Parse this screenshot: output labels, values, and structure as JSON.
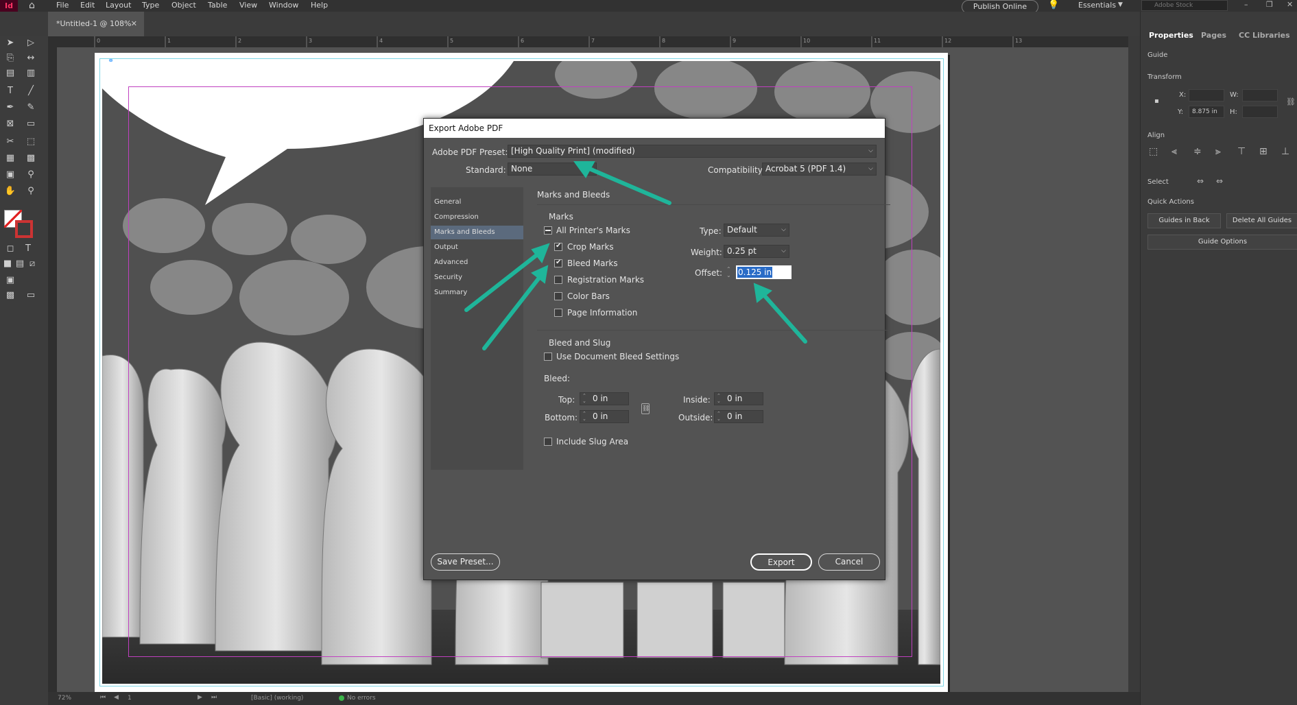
{
  "app": {
    "logo": "Id",
    "menu": [
      "File",
      "Edit",
      "Layout",
      "Type",
      "Object",
      "Table",
      "View",
      "Window",
      "Help"
    ],
    "publish_label": "Publish Online",
    "workspace": "Essentials",
    "stock_placeholder": "Adobe Stock"
  },
  "document": {
    "tab_label": "*Untitled-1 @ 108%",
    "ruler_ticks": [
      "0",
      "1",
      "2",
      "3",
      "4",
      "5",
      "6",
      "7",
      "8",
      "9",
      "10",
      "11",
      "12",
      "13"
    ]
  },
  "status": {
    "zoom": "72%",
    "page": "1",
    "style": "[Basic] (working)",
    "errors": "No errors"
  },
  "right_panel": {
    "tabs": [
      "Properties",
      "Pages",
      "CC Libraries"
    ],
    "context": "Guide",
    "transform_label": "Transform",
    "x_label": "X:",
    "y_label": "Y:",
    "w_label": "W:",
    "h_label": "H:",
    "y_value": "8.875 in",
    "align_label": "Align",
    "select_label": "Select",
    "quick_actions_label": "Quick Actions",
    "guides_in_back": "Guides in Back",
    "delete_all_guides": "Delete All Guides",
    "guide_options": "Guide Options"
  },
  "dialog": {
    "title": "Export Adobe PDF",
    "preset_label": "Adobe PDF Preset:",
    "preset_value": "[High Quality Print] (modified)",
    "standard_label": "Standard:",
    "standard_value": "None",
    "compat_label": "Compatibility:",
    "compat_value": "Acrobat 5 (PDF 1.4)",
    "sections": [
      "General",
      "Compression",
      "Marks and Bleeds",
      "Output",
      "Advanced",
      "Security",
      "Summary"
    ],
    "active_section": "Marks and Bleeds",
    "panel_title": "Marks and Bleeds",
    "marks_group": "Marks",
    "all_printers_marks": "All Printer's Marks",
    "crop_marks": "Crop Marks",
    "bleed_marks": "Bleed Marks",
    "registration_marks": "Registration Marks",
    "color_bars": "Color Bars",
    "page_information": "Page Information",
    "type_label": "Type:",
    "type_value": "Default",
    "weight_label": "Weight:",
    "weight_value": "0.25 pt",
    "offset_label": "Offset:",
    "offset_value": "0.125 in",
    "bleed_slug_group": "Bleed and Slug",
    "use_doc_bleed": "Use Document Bleed Settings",
    "bleed_label": "Bleed:",
    "top_label": "Top:",
    "top_value": "0 in",
    "bottom_label": "Bottom:",
    "bottom_value": "0 in",
    "inside_label": "Inside:",
    "inside_value": "0 in",
    "outside_label": "Outside:",
    "outside_value": "0 in",
    "include_slug": "Include Slug Area",
    "save_preset": "Save Preset...",
    "export": "Export",
    "cancel": "Cancel"
  },
  "colors": {
    "arrow": "#1fb59a",
    "selection": "#2a6cc7",
    "margin_guide": "#c040c0",
    "bleed_guide": "#7fd7e6"
  }
}
